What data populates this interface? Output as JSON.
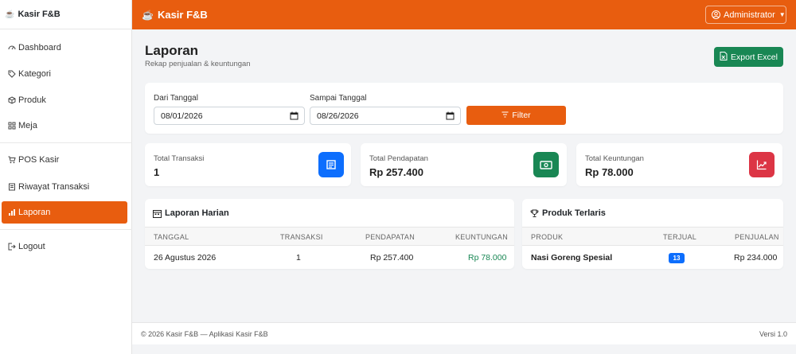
{
  "brand": {
    "name": "Kasir F&B"
  },
  "sidebar": {
    "items": [
      {
        "label": "Dashboard",
        "icon": "speedometer-icon"
      },
      {
        "label": "Kategori",
        "icon": "tag-icon"
      },
      {
        "label": "Produk",
        "icon": "box-icon"
      },
      {
        "label": "Meja",
        "icon": "grid-icon"
      },
      {
        "label": "POS Kasir",
        "icon": "cart-icon"
      },
      {
        "label": "Riwayat Transaksi",
        "icon": "receipt-icon"
      },
      {
        "label": "Laporan",
        "icon": "bar-chart-icon",
        "active": true
      },
      {
        "label": "Logout",
        "icon": "logout-icon"
      }
    ]
  },
  "header": {
    "title": "Kasir F&B",
    "user": "Administrator"
  },
  "page": {
    "title": "Laporan",
    "subtitle": "Rekap penjualan & keuntungan",
    "export_label": "Export Excel"
  },
  "filter": {
    "from_label": "Dari Tanggal",
    "from_value": "08/01/2026",
    "to_label": "Sampai Tanggal",
    "to_value": "08/26/2026",
    "button_label": "Filter"
  },
  "stats": [
    {
      "label": "Total Transaksi",
      "value": "1",
      "color": "#0d6efd"
    },
    {
      "label": "Total Pendapatan",
      "value": "Rp 257.400",
      "color": "#198754"
    },
    {
      "label": "Total Keuntungan",
      "value": "Rp 78.000",
      "color": "#dc3545"
    }
  ],
  "daily_report": {
    "title": "Laporan Harian",
    "columns": [
      "TANGGAL",
      "TRANSAKSI",
      "PENDAPATAN",
      "KEUNTUNGAN"
    ],
    "rows": [
      {
        "tanggal": "26 Agustus 2026",
        "transaksi": "1",
        "pendapatan": "Rp 257.400",
        "keuntungan": "Rp 78.000"
      }
    ]
  },
  "top_products": {
    "title": "Produk Terlaris",
    "columns": [
      "PRODUK",
      "TERJUAL",
      "PENJUALAN"
    ],
    "rows": [
      {
        "produk": "Nasi Goreng Spesial",
        "terjual": "13",
        "penjualan": "Rp 234.000"
      }
    ]
  },
  "footer": {
    "left": "© 2026 Kasir F&B — Aplikasi Kasir F&B",
    "right": "Versi 1.0"
  },
  "colors": {
    "accent": "#e85d0f",
    "success": "#198754",
    "primary": "#0d6efd",
    "danger": "#dc3545",
    "profit_text": "#198754"
  }
}
